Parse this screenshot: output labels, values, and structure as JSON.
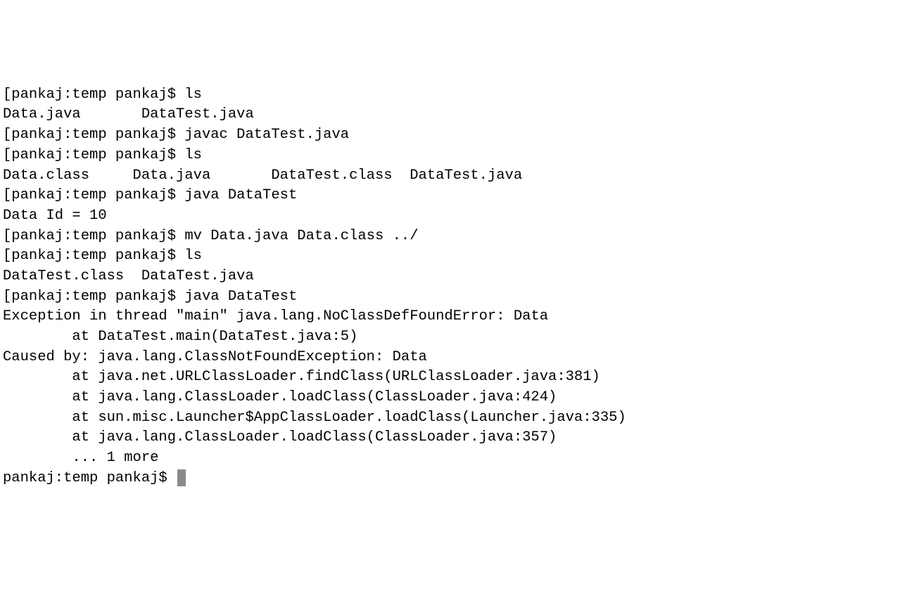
{
  "terminal": {
    "lines": [
      "[pankaj:temp pankaj$ ls",
      "Data.java       DataTest.java",
      "[pankaj:temp pankaj$ javac DataTest.java",
      "[pankaj:temp pankaj$ ls",
      "Data.class     Data.java       DataTest.class  DataTest.java",
      "[pankaj:temp pankaj$ java DataTest",
      "Data Id = 10",
      "[pankaj:temp pankaj$ mv Data.java Data.class ../",
      "[pankaj:temp pankaj$ ls",
      "DataTest.class  DataTest.java",
      "[pankaj:temp pankaj$ java DataTest",
      "Exception in thread \"main\" java.lang.NoClassDefFoundError: Data",
      "        at DataTest.main(DataTest.java:5)",
      "Caused by: java.lang.ClassNotFoundException: Data",
      "        at java.net.URLClassLoader.findClass(URLClassLoader.java:381)",
      "        at java.lang.ClassLoader.loadClass(ClassLoader.java:424)",
      "        at sun.misc.Launcher$AppClassLoader.loadClass(Launcher.java:335)",
      "        at java.lang.ClassLoader.loadClass(ClassLoader.java:357)",
      "        ... 1 more"
    ],
    "current_prompt": "pankaj:temp pankaj$ "
  }
}
